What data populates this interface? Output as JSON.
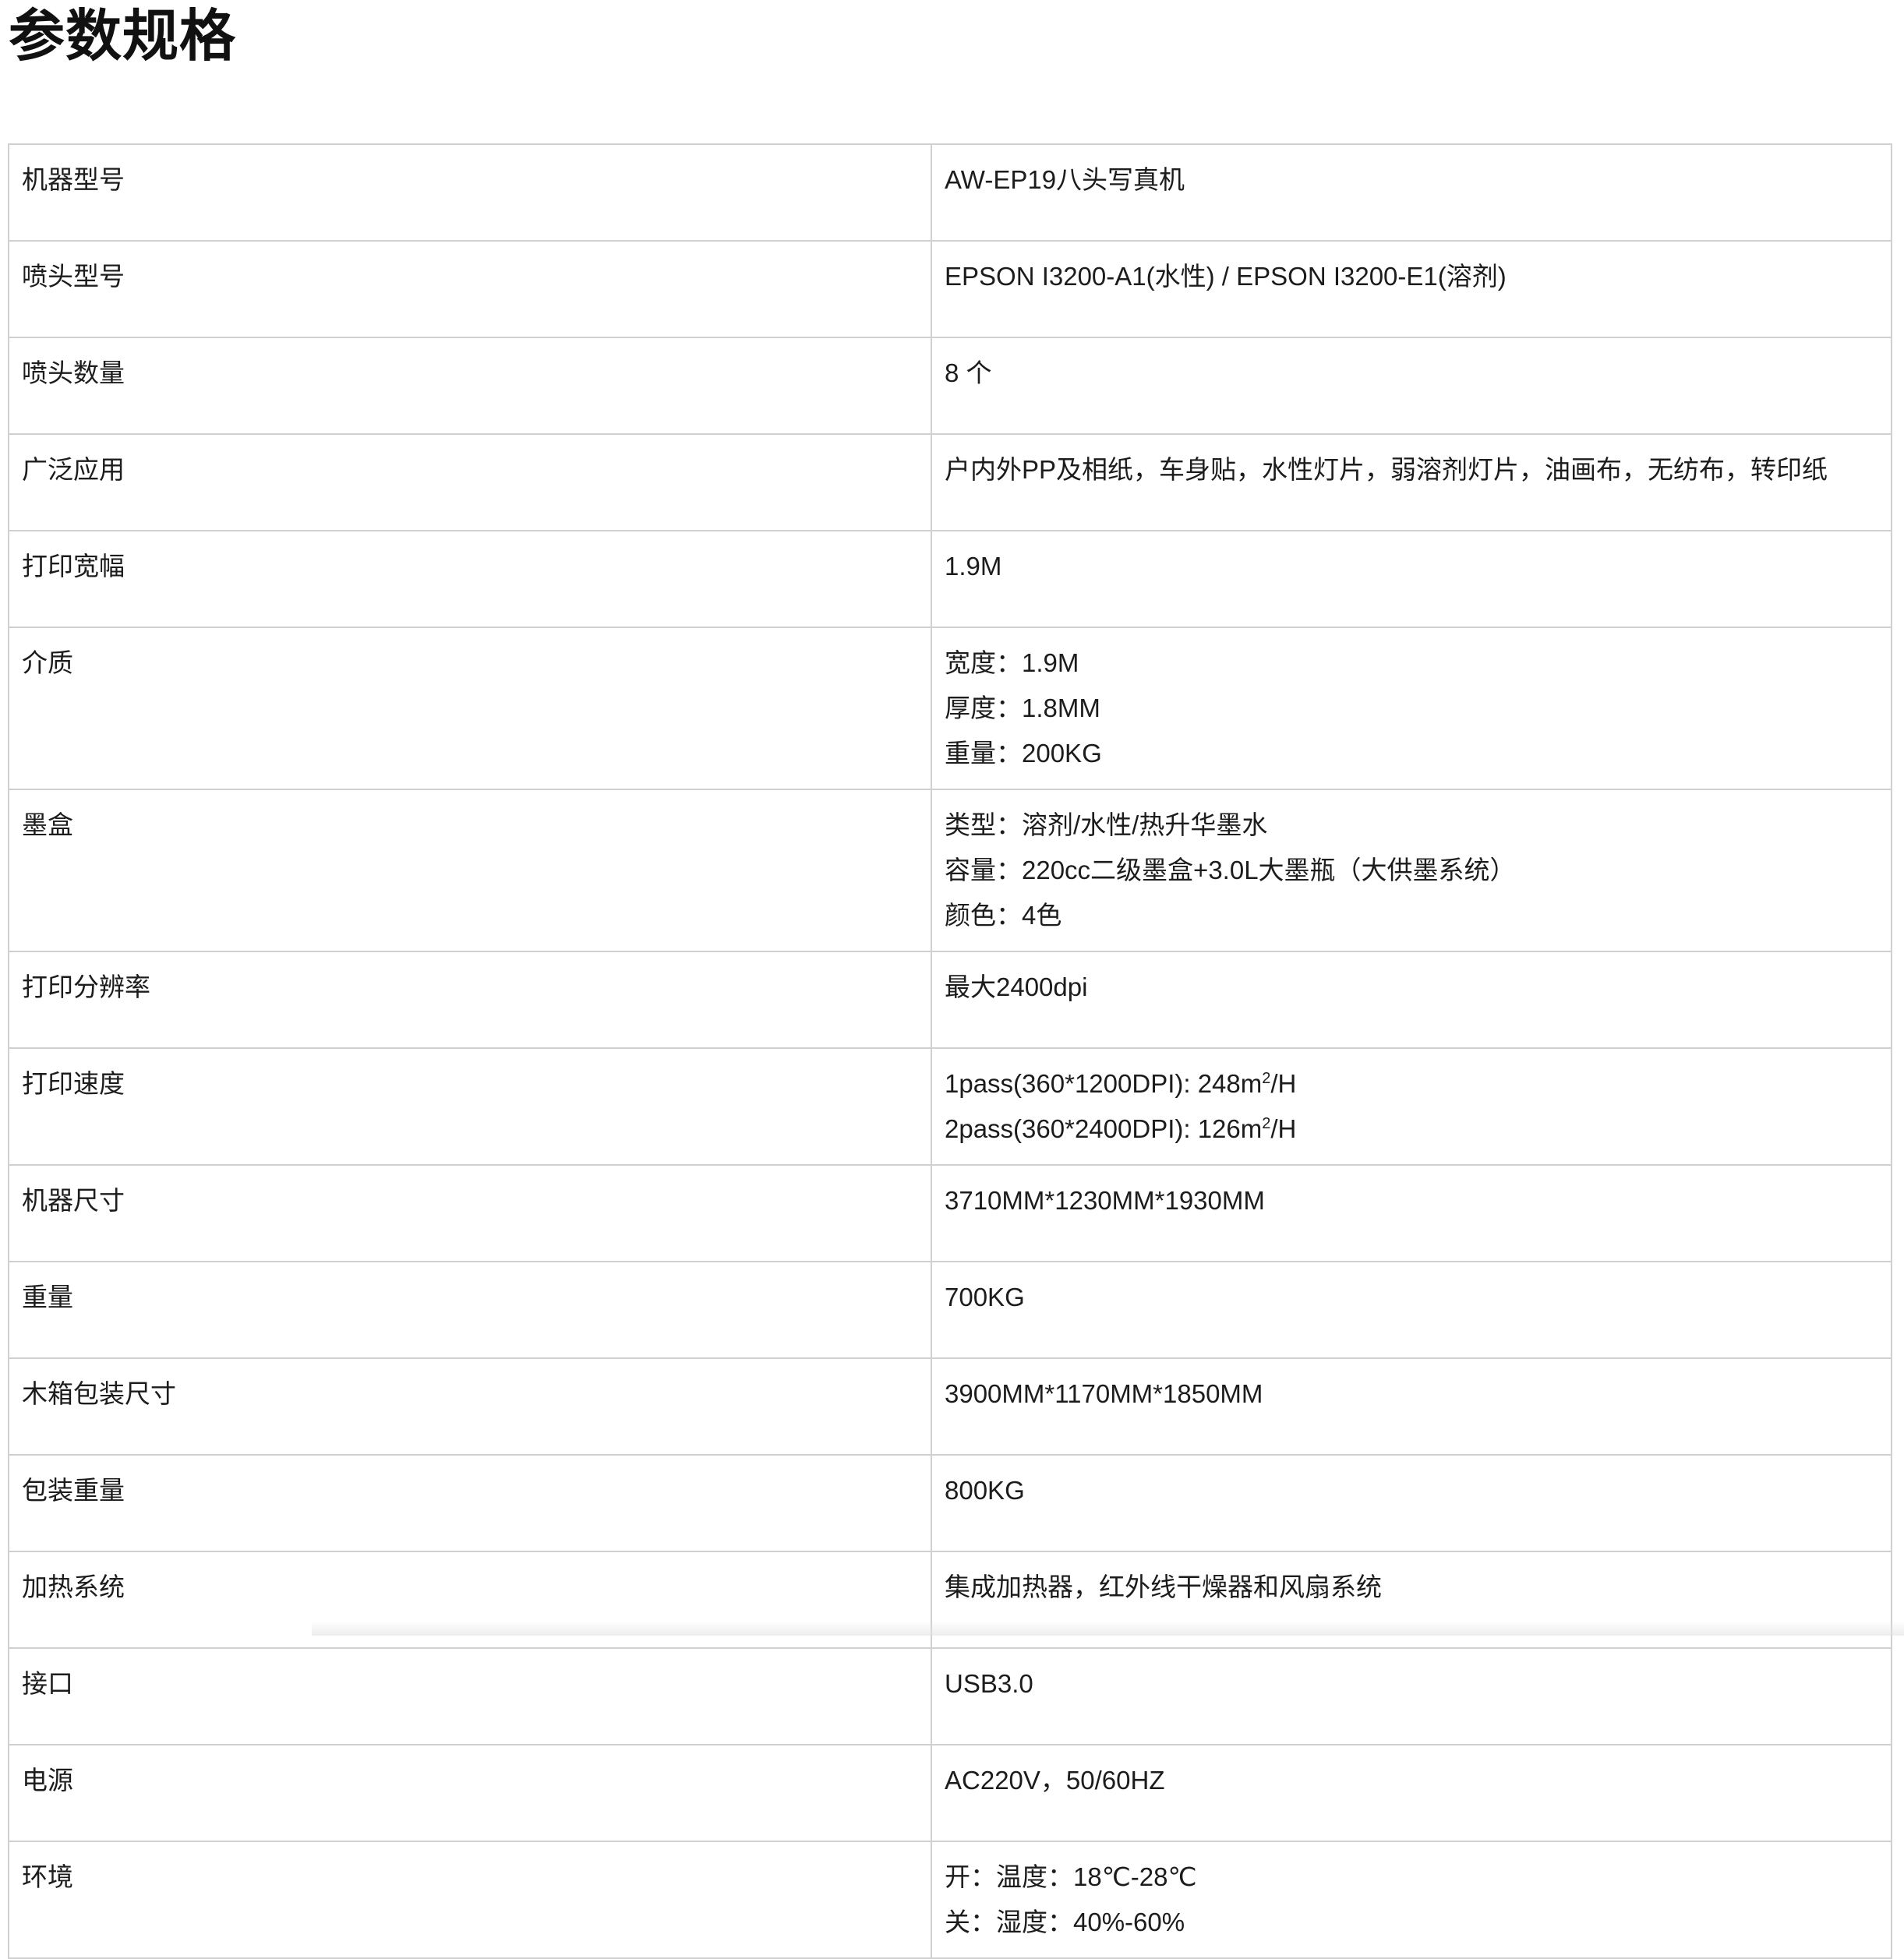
{
  "title": "参数规格",
  "specs": [
    {
      "label": "机器型号",
      "lines": [
        "AW-EP19八头写真机"
      ]
    },
    {
      "label": "喷头型号",
      "lines": [
        "EPSON I3200-A1(水性) / EPSON I3200-E1(溶剂)"
      ]
    },
    {
      "label": "喷头数量",
      "lines": [
        "8 个"
      ]
    },
    {
      "label": "广泛应用",
      "lines": [
        "户内外PP及相纸，车身贴，水性灯片，弱溶剂灯片，油画布，无纺布，转印纸"
      ]
    },
    {
      "label": "打印宽幅",
      "lines": [
        "1.9M"
      ]
    },
    {
      "label": "介质",
      "lines": [
        "宽度：1.9M",
        "厚度：1.8MM",
        "重量：200KG"
      ]
    },
    {
      "label": "墨盒",
      "lines": [
        "类型：溶剂/水性/热升华墨水",
        "容量：220cc二级墨盒+3.0L大墨瓶（大供墨系统）",
        "颜色：4色"
      ]
    },
    {
      "label": "打印分辨率",
      "lines": [
        "最大2400dpi"
      ]
    },
    {
      "label": "打印速度",
      "speed": [
        {
          "prefix": "1pass(360*1200DPI): 248m",
          "sup": "2",
          "suffix": "/H"
        },
        {
          "prefix": "2pass(360*2400DPI): 126m",
          "sup": "2",
          "suffix": "/H"
        }
      ]
    },
    {
      "label": "机器尺寸",
      "lines": [
        "3710MM*1230MM*1930MM"
      ]
    },
    {
      "label": "重量",
      "lines": [
        "700KG"
      ]
    },
    {
      "label": "木箱包装尺寸",
      "lines": [
        "3900MM*1170MM*1850MM"
      ]
    },
    {
      "label": "包装重量",
      "lines": [
        "800KG"
      ]
    },
    {
      "label": "加热系统",
      "lines": [
        "集成加热器，红外线干燥器和风扇系统"
      ]
    },
    {
      "label": "接口",
      "lines": [
        "USB3.0"
      ]
    },
    {
      "label": "电源",
      "lines": [
        "AC220V，50/60HZ"
      ]
    },
    {
      "label": "环境",
      "lines": [
        "开：温度：18℃-28℃",
        "关：湿度：40%-60%"
      ]
    }
  ]
}
